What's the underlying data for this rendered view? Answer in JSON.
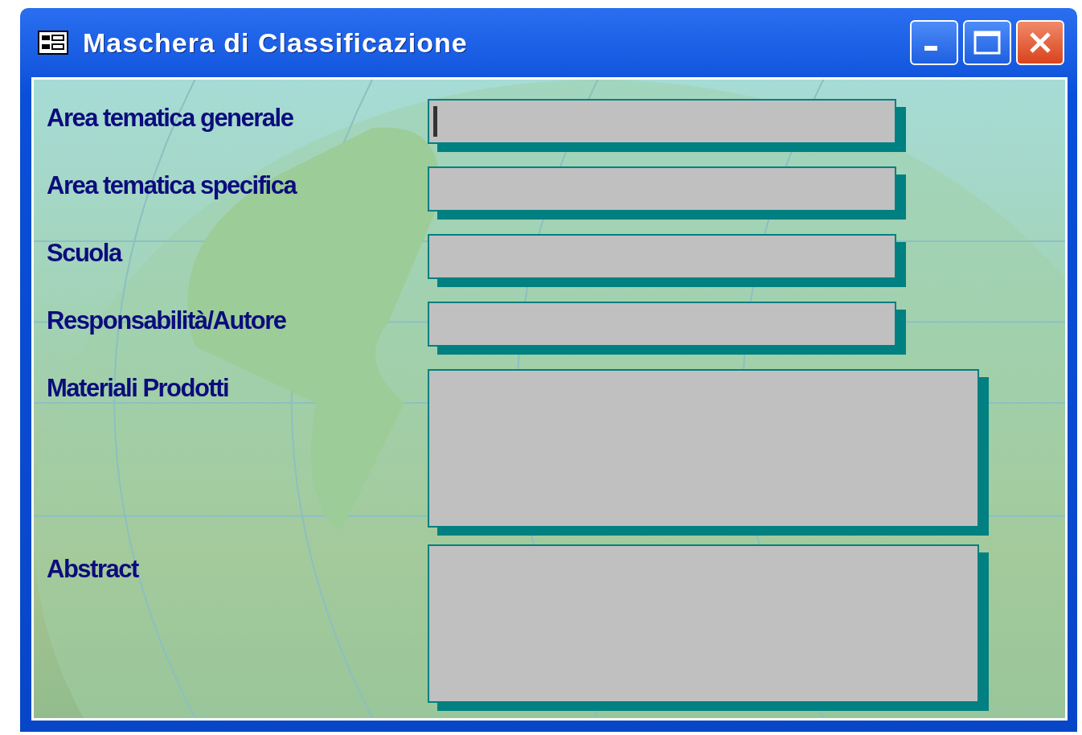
{
  "window": {
    "title": "Maschera di Classificazione"
  },
  "fields": [
    {
      "label": "Area tematica generale",
      "kind": "single",
      "focused": true
    },
    {
      "label": "Area tematica specifica",
      "kind": "single",
      "focused": false
    },
    {
      "label": "Scuola",
      "kind": "single",
      "focused": false
    },
    {
      "label": "Responsabilità/Autore",
      "kind": "single",
      "focused": false
    },
    {
      "label": "Materiali Prodotti",
      "kind": "multi",
      "focused": false
    },
    {
      "label": "Abstract",
      "kind": "multi",
      "focused": false
    }
  ]
}
